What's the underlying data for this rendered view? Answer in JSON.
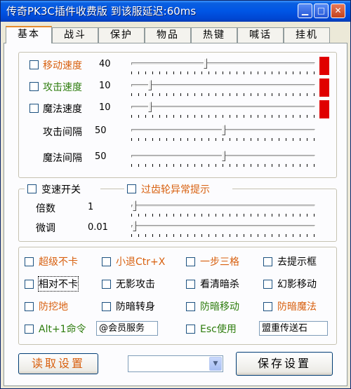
{
  "window": {
    "title": "传奇PK3C插件收费版  到该服延迟:60ms",
    "min_glyph": "▁",
    "max_glyph": "□",
    "close_glyph": "✕"
  },
  "tabs": [
    "基本",
    "战斗",
    "保护",
    "物品",
    "热键",
    "喊话",
    "挂机"
  ],
  "active_tab": "基本",
  "speed_group": {
    "rows": [
      {
        "label": "移动速度",
        "value": "40",
        "color": "#D8600F",
        "checkbox": true,
        "checked": false,
        "level": 0.4,
        "indicator": "#E00000"
      },
      {
        "label": "攻击速度",
        "value": "10",
        "color": "#2E7D0E",
        "checkbox": true,
        "checked": false,
        "level": 0.1,
        "indicator": "#E00000"
      },
      {
        "label": "魔法速度",
        "value": "10",
        "color": "#000000",
        "checkbox": true,
        "checked": false,
        "level": 0.1,
        "indicator": "#E00000"
      },
      {
        "label": "攻击间隔",
        "value": "50",
        "color": "#000000",
        "checkbox": false,
        "level": 0.5
      },
      {
        "label": "魔法间隔",
        "value": "50",
        "color": "#000000",
        "checkbox": false,
        "level": 0.5
      }
    ]
  },
  "shift_group": {
    "toggle_label": "变速开关",
    "gear_label": "过齿轮异常提示",
    "multiplier_label": "倍数",
    "multiplier_value": "1",
    "fine_label": "微调",
    "fine_value": "0.01"
  },
  "options": [
    {
      "label": "超级不卡",
      "color": "#D8600F"
    },
    {
      "label": "小退Ctr+X",
      "color": "#D8600F"
    },
    {
      "label": "一步三格",
      "color": "#D8600F"
    },
    {
      "label": "去提示框",
      "color": "#000000"
    },
    {
      "label": "相对不卡",
      "color": "#000000"
    },
    {
      "label": "无影攻击",
      "color": "#000000"
    },
    {
      "label": "看清暗杀",
      "color": "#000000"
    },
    {
      "label": "幻影移动",
      "color": "#000000"
    },
    {
      "label": "防挖地",
      "color": "#D8600F"
    },
    {
      "label": "防暗转身",
      "color": "#000000"
    },
    {
      "label": "防暗移动",
      "color": "#2E7D0E"
    },
    {
      "label": "防暗魔法",
      "color": "#D8600F"
    },
    {
      "label": "Alt+1命令",
      "color": "#2E7D0E"
    },
    {
      "label": "",
      "color": "#000000"
    },
    {
      "label": "Esc使用",
      "color": "#2E7D0E"
    },
    {
      "label": "",
      "color": "#000000"
    }
  ],
  "alt1_input_value": "@会员服务",
  "esc_input_value": "盟重传送石",
  "buttons": {
    "load": "读取设置",
    "save": "保存设置"
  },
  "combo": {
    "value": "",
    "arrow_glyph": "▼"
  }
}
